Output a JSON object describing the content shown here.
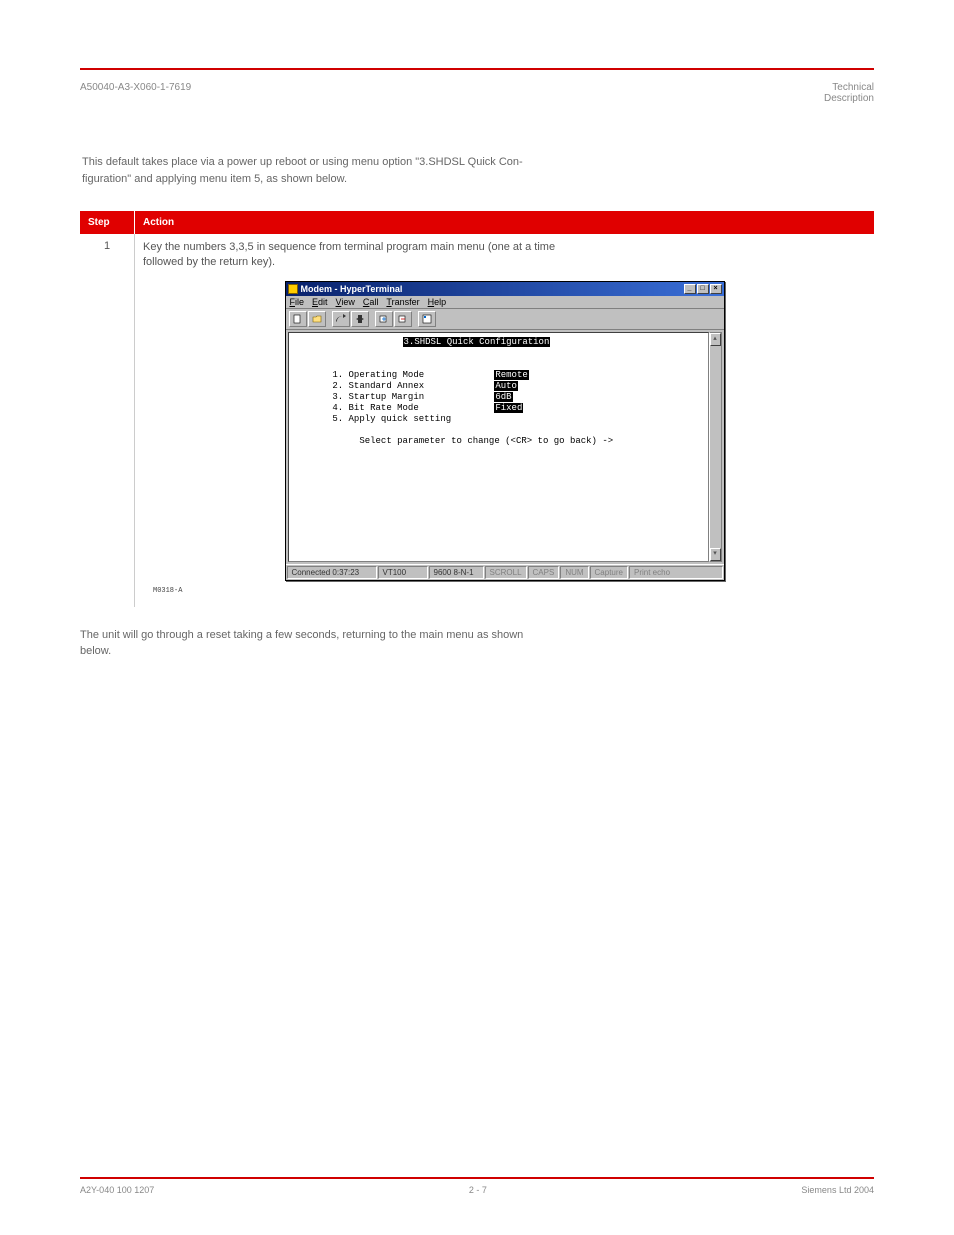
{
  "header": {
    "left": "A50040-A3-X060-1-7619",
    "right": "Technical",
    "right2": "Description",
    "intro": "This default takes place via a power up reboot or using menu option \"3.SHDSL Quick Con-\nfiguration\" and applying menu item 5, as shown below."
  },
  "table": {
    "col_step": "Step",
    "col_action": "Action",
    "row1_step": "1",
    "row1_desc": "Key the numbers 3,3,5 in sequence from terminal program main menu (one at a time\nfollowed by the return key)."
  },
  "ht": {
    "title": "Modem - HyperTerminal",
    "menu": {
      "file": "File",
      "edit": "Edit",
      "view": "View",
      "call": "Call",
      "transfer": "Transfer",
      "help": "Help"
    },
    "terminal": {
      "heading": "3.SHDSL Quick Configuration",
      "line1_label": "1. Operating Mode",
      "line1_val": "Remote",
      "line2_label": "2. Standard Annex",
      "line2_val": "Auto",
      "line3_label": "3. Startup Margin",
      "line3_val": "6dB",
      "line4_label": "4. Bit Rate Mode",
      "line4_val": "Fixed",
      "line5_label": "5. Apply quick setting",
      "prompt": "Select parameter to change (<CR> to go back) ->"
    },
    "status": {
      "conn": "Connected 0:37:23",
      "term": "VT100",
      "baud": "9600 8-N-1",
      "scroll": "SCROLL",
      "caps": "CAPS",
      "num": "NUM",
      "capture": "Capture",
      "printecho": "Print echo"
    },
    "fig_label": "M0318-A"
  },
  "followup": "The unit will go through a reset taking a few seconds, returning to the main menu as shown\nbelow.",
  "footer": {
    "left": "A2Y-040 100 1207",
    "center": "2 - 7",
    "right": "Siemens Ltd 2004"
  }
}
